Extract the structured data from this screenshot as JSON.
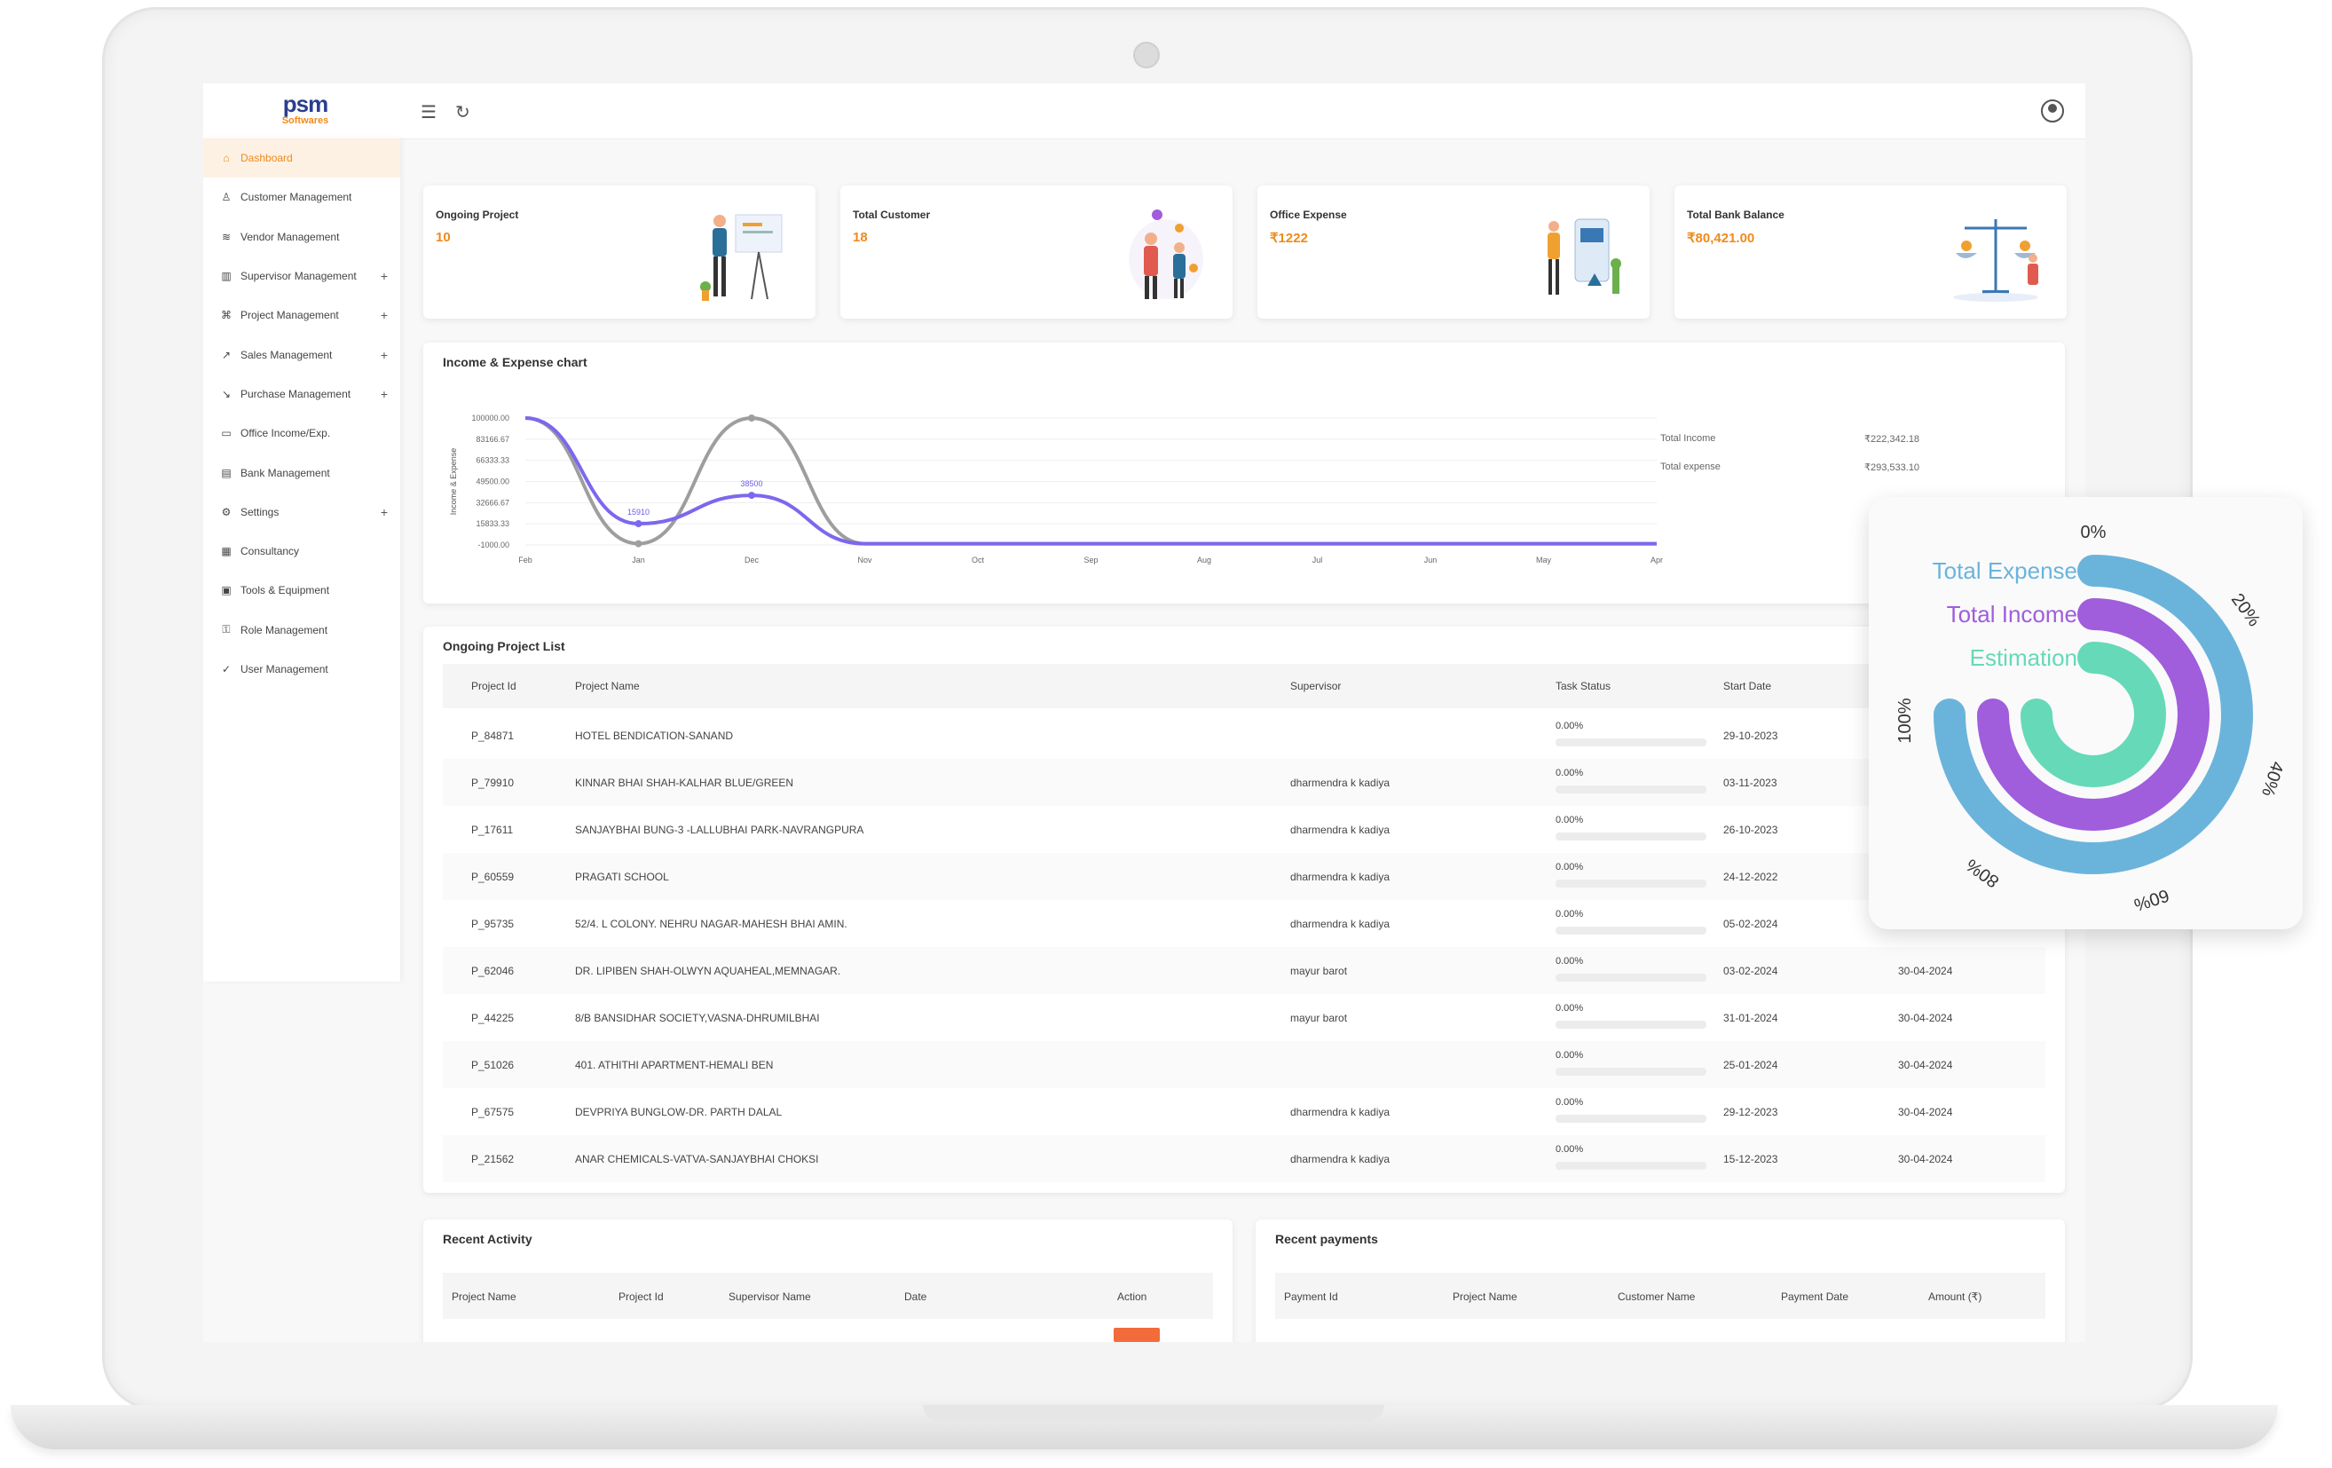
{
  "brand": {
    "logo_text": "psm",
    "logo_sub": "Softwares"
  },
  "topbar": {
    "menu_icon": "hamburger-icon",
    "refresh_icon": "refresh-icon",
    "profile_icon": "user-circle-icon"
  },
  "sidebar": {
    "items": [
      {
        "label": "Dashboard",
        "icon": "home-icon",
        "active": true,
        "expandable": false
      },
      {
        "label": "Customer Management",
        "icon": "user-icon",
        "expandable": false
      },
      {
        "label": "Vendor Management",
        "icon": "layers-icon",
        "expandable": false
      },
      {
        "label": "Supervisor Management",
        "icon": "bar-chart-icon",
        "expandable": true
      },
      {
        "label": "Project Management",
        "icon": "command-icon",
        "expandable": true
      },
      {
        "label": "Sales Management",
        "icon": "trending-up-icon",
        "expandable": true
      },
      {
        "label": "Purchase Management",
        "icon": "trending-down-icon",
        "expandable": true
      },
      {
        "label": "Office Income/Exp.",
        "icon": "briefcase-icon",
        "expandable": false
      },
      {
        "label": "Bank Management",
        "icon": "bank-icon",
        "expandable": false
      },
      {
        "label": "Settings",
        "icon": "gear-icon",
        "expandable": true
      },
      {
        "label": "Consultancy",
        "icon": "building-icon",
        "expandable": false
      },
      {
        "label": "Tools & Equipment",
        "icon": "toolbox-icon",
        "expandable": false
      },
      {
        "label": "Role Management",
        "icon": "key-icon",
        "expandable": false
      },
      {
        "label": "User Management",
        "icon": "user-check-icon",
        "expandable": false
      }
    ],
    "plus_symbol": "+"
  },
  "cards": [
    {
      "label": "Ongoing Project",
      "value": "10"
    },
    {
      "label": "Total Customer",
      "value": "18"
    },
    {
      "label": "Office Expense",
      "value": "₹1222"
    },
    {
      "label": "Total Bank Balance",
      "value": "₹80,421.00"
    }
  ],
  "income_chart": {
    "title": "Income & Expense chart",
    "totals": [
      {
        "label": "Total Income",
        "value": "₹222,342.18"
      },
      {
        "label": "Total expense",
        "value": "₹293,533.10"
      }
    ]
  },
  "chart_data": {
    "type": "line",
    "ylabel": "Income & Expense",
    "y_ticks": [
      "100000.00",
      "83166.67",
      "66333.33",
      "49500.00",
      "32666.67",
      "15833.33",
      "-1000.00"
    ],
    "ylim": [
      -1000,
      100000
    ],
    "categories": [
      "Feb",
      "Jan",
      "Dec",
      "Nov",
      "Oct",
      "Sep",
      "Aug",
      "Jul",
      "Jun",
      "May",
      "Apr"
    ],
    "series": [
      {
        "values": [
          100000,
          0,
          100000,
          0,
          0,
          0,
          0,
          0,
          0,
          0,
          0
        ],
        "color": "#9e9e9e"
      },
      {
        "values": [
          100000,
          15910,
          38500,
          0,
          0,
          0,
          0,
          0,
          0,
          0,
          0
        ],
        "color": "#7b68ee"
      }
    ],
    "data_labels": [
      "15910",
      "38500"
    ],
    "grid": true
  },
  "project_list": {
    "title": "Ongoing Project List",
    "columns": [
      "Project Id",
      "Project Name",
      "Supervisor",
      "Task Status",
      "Start Date"
    ],
    "rows": [
      {
        "id": "P_84871",
        "name": "HOTEL BENDICATION-SANAND",
        "supervisor": "",
        "status": "0.00%",
        "start": "29-10-2023",
        "end": ""
      },
      {
        "id": "P_79910",
        "name": "KINNAR BHAI SHAH-KALHAR BLUE/GREEN",
        "supervisor": "dharmendra k kadiya",
        "status": "0.00%",
        "start": "03-11-2023",
        "end": ""
      },
      {
        "id": "P_17611",
        "name": "SANJAYBHAI BUNG-3 -LALLUBHAI PARK-NAVRANGPURA",
        "supervisor": "dharmendra k kadiya",
        "status": "0.00%",
        "start": "26-10-2023",
        "end": ""
      },
      {
        "id": "P_60559",
        "name": "PRAGATI SCHOOL",
        "supervisor": "dharmendra k kadiya",
        "status": "0.00%",
        "start": "24-12-2022",
        "end": ""
      },
      {
        "id": "P_95735",
        "name": "52/4. L COLONY. NEHRU NAGAR-MAHESH BHAI AMIN.",
        "supervisor": "dharmendra k kadiya",
        "status": "0.00%",
        "start": "05-02-2024",
        "end": ""
      },
      {
        "id": "P_62046",
        "name": "DR. LIPIBEN SHAH-OLWYN AQUAHEAL,MEMNAGAR.",
        "supervisor": "mayur barot",
        "status": "0.00%",
        "start": "03-02-2024",
        "end": "30-04-2024"
      },
      {
        "id": "P_44225",
        "name": "8/B BANSIDHAR SOCIETY,VASNA-DHRUMILBHAI",
        "supervisor": "mayur barot",
        "status": "0.00%",
        "start": "31-01-2024",
        "end": "30-04-2024"
      },
      {
        "id": "P_51026",
        "name": "401. ATHITHI APARTMENT-HEMALI BEN",
        "supervisor": "",
        "status": "0.00%",
        "start": "25-01-2024",
        "end": "30-04-2024"
      },
      {
        "id": "P_67575",
        "name": "DEVPRIYA BUNGLOW-DR. PARTH DALAL",
        "supervisor": "dharmendra k kadiya",
        "status": "0.00%",
        "start": "29-12-2023",
        "end": "30-04-2024"
      },
      {
        "id": "P_21562",
        "name": "ANAR CHEMICALS-VATVA-SANJAYBHAI CHOKSI",
        "supervisor": "dharmendra k kadiya",
        "status": "0.00%",
        "start": "15-12-2023",
        "end": "30-04-2024"
      }
    ]
  },
  "recent_activity": {
    "title": "Recent Activity",
    "columns": [
      "Project Name",
      "Project Id",
      "Supervisor Name",
      "Date",
      "Action"
    ]
  },
  "recent_payments": {
    "title": "Recent payments",
    "columns": [
      "Payment Id",
      "Project Name",
      "Customer Name",
      "Payment Date",
      "Amount (₹)"
    ]
  },
  "donut": {
    "legend": [
      {
        "label": "Total Expense",
        "color": "#6ab4dc",
        "fraction": 0.75
      },
      {
        "label": "Total Income",
        "color": "#a05ddc",
        "fraction": 0.75
      },
      {
        "label": "Estimation",
        "color": "#66d9b8",
        "fraction": 0.75
      }
    ],
    "ticks": [
      "0%",
      "20%",
      "40%",
      "60%",
      "80%",
      "100%"
    ]
  }
}
